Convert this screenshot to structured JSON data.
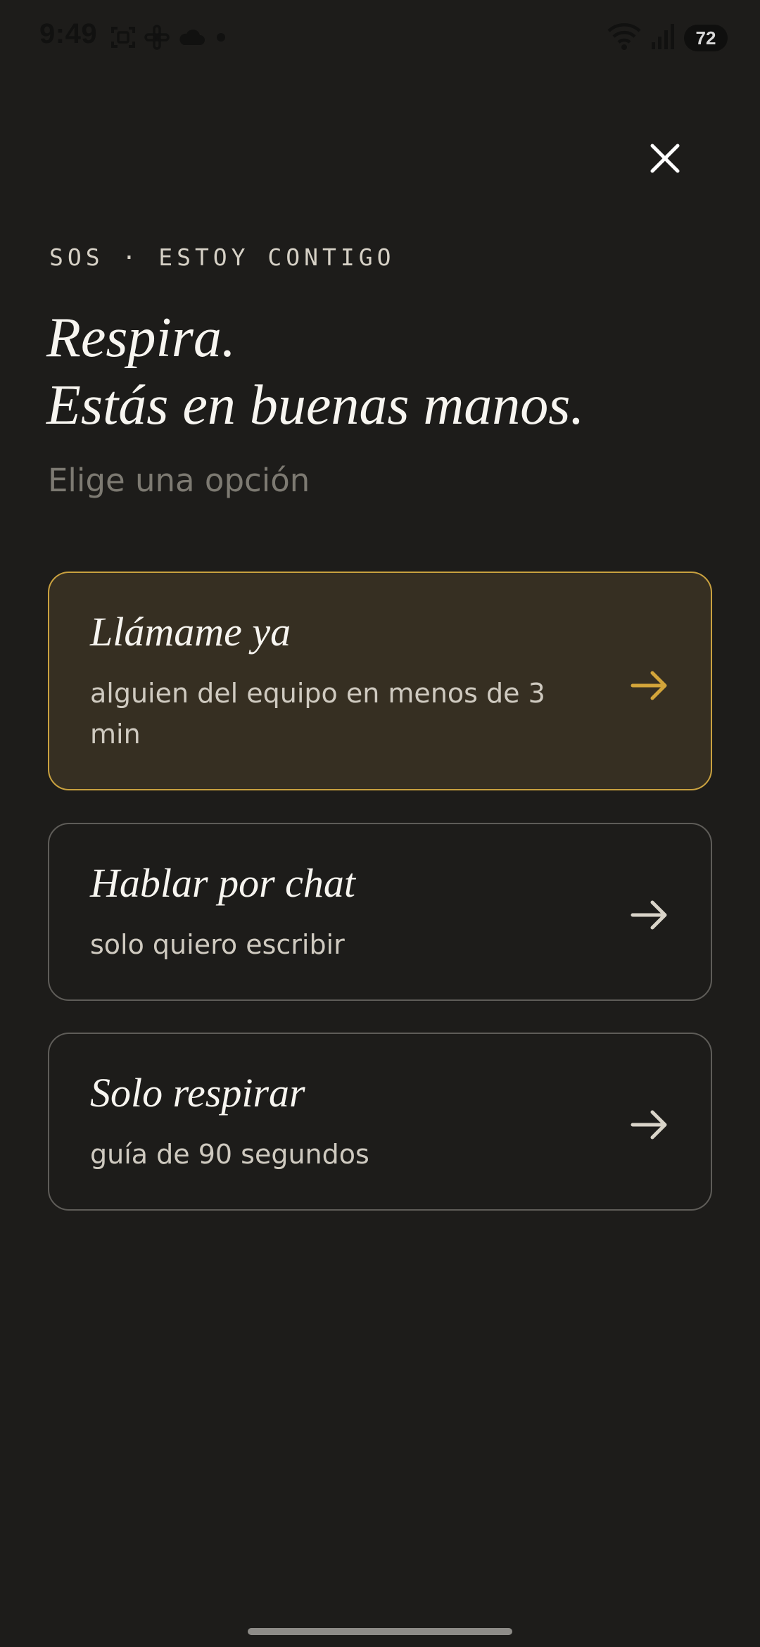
{
  "status_bar": {
    "time": "9:49",
    "battery": "72",
    "icons_left": [
      "screenshot-icon",
      "slack-icon",
      "cloud-icon",
      "dot-icon"
    ],
    "icons_right": [
      "wifi-icon",
      "signal-icon",
      "battery-icon"
    ]
  },
  "header": {
    "eyebrow": "SOS · ESTOY CONTIGO",
    "headline_line1": "Respira.",
    "headline_line2": "Estás en buenas manos.",
    "subhead": "Elige una opción"
  },
  "options": [
    {
      "title": "Llámame ya",
      "subtitle": "alguien del equipo en menos de 3 min",
      "highlighted": true
    },
    {
      "title": "Hablar por chat",
      "subtitle": "solo quiero escribir",
      "highlighted": false
    },
    {
      "title": "Solo respirar",
      "subtitle": "guía de 90 segundos",
      "highlighted": false
    }
  ],
  "colors": {
    "background": "#1d1c1a",
    "accent": "#c9a13f",
    "primary_card_bg": "#362f22",
    "card_border": "#5e5c58",
    "muted_text": "#7d7a72"
  }
}
